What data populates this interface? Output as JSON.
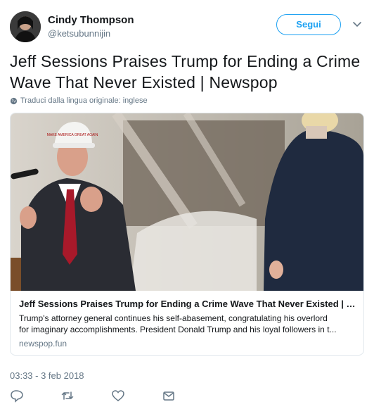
{
  "user": {
    "name": "Cindy Thompson",
    "handle": "@ketsubunnijin",
    "avatar_icon": "profile-photo"
  },
  "follow_label": "Segui",
  "more_icon": "chevron-down-icon",
  "tweet": {
    "text": "Jeff Sessions Praises Trump for Ending a Crime Wave That Never Existed | Newspop",
    "translate_label": "Traduci dalla lingua originale: inglese",
    "timestamp": "03:33 - 3 feb 2018"
  },
  "card": {
    "title": "Jeff Sessions Praises Trump for Ending a Crime Wave That Never Existed | N...",
    "description_line1": "Trump's attorney general continues his self-abasement, congratulating his overlord",
    "description_line2": "for imaginary accomplishments. President Donald Trump and his loyal followers in t...",
    "domain": "newspop.fun",
    "hat_text": "MAKE AMERICA GREAT AGAIN"
  },
  "actions": [
    "reply-icon",
    "retweet-icon",
    "like-icon",
    "message-icon"
  ],
  "colors": {
    "accent": "#1da1f2",
    "muted": "#657786",
    "border": "#e1e8ed"
  }
}
